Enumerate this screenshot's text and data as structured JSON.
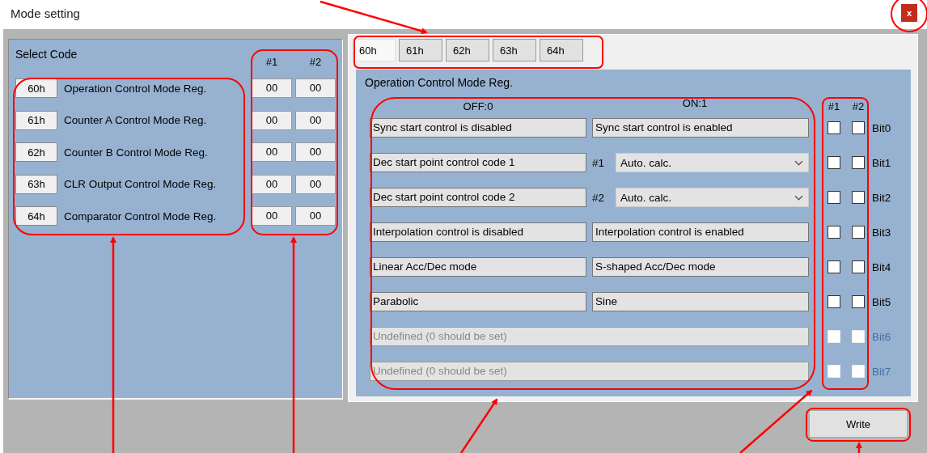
{
  "window": {
    "title": "Mode setting",
    "close_label": "x"
  },
  "select_code": {
    "title": "Select Code",
    "value_headers": [
      "#1",
      "#2"
    ],
    "rows": [
      {
        "code": "60h",
        "name": "Operation Control Mode Reg.",
        "values": [
          "00",
          "00"
        ]
      },
      {
        "code": "61h",
        "name": "Counter A Control Mode Reg.",
        "values": [
          "00",
          "00"
        ]
      },
      {
        "code": "62h",
        "name": "Counter B Control Mode Reg.",
        "values": [
          "00",
          "00"
        ]
      },
      {
        "code": "63h",
        "name": "CLR Output Control Mode Reg.",
        "values": [
          "00",
          "00"
        ]
      },
      {
        "code": "64h",
        "name": "Comparator Control Mode Reg.",
        "values": [
          "00",
          "00"
        ]
      }
    ]
  },
  "tabs": [
    {
      "label": "60h",
      "selected": true
    },
    {
      "label": "61h",
      "selected": false
    },
    {
      "label": "62h",
      "selected": false
    },
    {
      "label": "63h",
      "selected": false
    },
    {
      "label": "64h",
      "selected": false
    }
  ],
  "register": {
    "title": "Operation Control Mode Reg.",
    "off_header": "OFF:0",
    "on_header": "ON:1",
    "check_headers": [
      "#1",
      "#2"
    ],
    "bits": [
      {
        "kind": "pair",
        "off": "Sync start control is disabled",
        "on": "Sync start control is enabled",
        "bit": "Bit0",
        "checks": [
          false,
          false
        ],
        "disabled": false
      },
      {
        "kind": "select",
        "off": "Dec start point control code 1",
        "select_label": "#1",
        "select_value": "Auto. calc.",
        "bit": "Bit1",
        "checks": [
          false,
          false
        ],
        "disabled": false
      },
      {
        "kind": "select",
        "off": "Dec start point control code 2",
        "select_label": "#2",
        "select_value": "Auto. calc.",
        "bit": "Bit2",
        "checks": [
          false,
          false
        ],
        "disabled": false
      },
      {
        "kind": "pair",
        "off": "Interpolation control is disabled",
        "on": "Interpolation control is enabled",
        "bit": "Bit3",
        "checks": [
          false,
          false
        ],
        "disabled": false
      },
      {
        "kind": "pair",
        "off": "Linear Acc/Dec mode",
        "on": "S-shaped Acc/Dec mode",
        "bit": "Bit4",
        "checks": [
          false,
          false
        ],
        "disabled": false
      },
      {
        "kind": "pair",
        "off": "Parabolic",
        "on": "Sine",
        "bit": "Bit5",
        "checks": [
          false,
          false
        ],
        "disabled": false
      },
      {
        "kind": "single",
        "off": "Undefined (0 should be set)",
        "bit": "Bit6",
        "checks": [
          false,
          false
        ],
        "disabled": true
      },
      {
        "kind": "single",
        "off": "Undefined (0 should be set)",
        "bit": "Bit7",
        "checks": [
          false,
          false
        ],
        "disabled": true
      }
    ]
  },
  "write_button": "Write"
}
